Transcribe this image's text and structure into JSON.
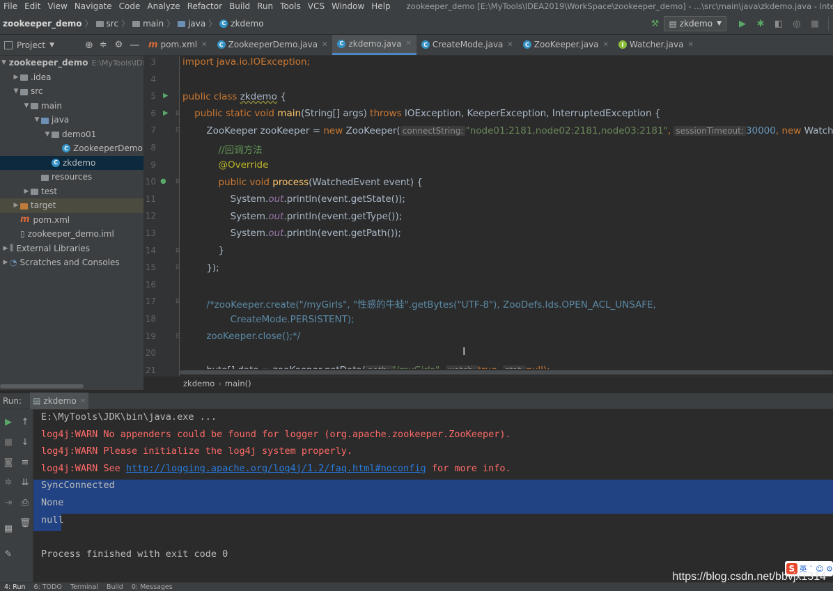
{
  "menu": [
    "File",
    "Edit",
    "View",
    "Navigate",
    "Code",
    "Analyze",
    "Refactor",
    "Build",
    "Run",
    "Tools",
    "VCS",
    "Window",
    "Help"
  ],
  "window_title": "zookeeper_demo [E:\\MyTools\\IDEA2019\\WorkSpace\\zookeeper_demo] - ...\\src\\main\\java\\zkdemo.java - IntelliJ IDEA",
  "breadcrumbs": [
    "zookeeper_demo",
    "src",
    "main",
    "java",
    "zkdemo"
  ],
  "run_config": "zkdemo",
  "project_panel": {
    "title": "Project",
    "tree": [
      {
        "label": "zookeeper_demo",
        "path": "E:\\MyTools\\IDEA201",
        "indent": 0,
        "arrow": "open",
        "icon": "folder",
        "bold": true
      },
      {
        "label": ".idea",
        "indent": 1,
        "arrow": "closed",
        "icon": "folder"
      },
      {
        "label": "src",
        "indent": 1,
        "arrow": "open",
        "icon": "folder"
      },
      {
        "label": "main",
        "indent": 2,
        "arrow": "open",
        "icon": "folder"
      },
      {
        "label": "java",
        "indent": 3,
        "arrow": "open",
        "icon": "folder-blue"
      },
      {
        "label": "demo01",
        "indent": 4,
        "arrow": "open",
        "icon": "folder"
      },
      {
        "label": "ZookeeperDemo",
        "indent": 5,
        "arrow": "none",
        "icon": "class"
      },
      {
        "label": "zkdemo",
        "indent": 4,
        "arrow": "none",
        "icon": "class",
        "selected": true
      },
      {
        "label": "resources",
        "indent": 3,
        "arrow": "none",
        "icon": "folder"
      },
      {
        "label": "test",
        "indent": 2,
        "arrow": "closed",
        "icon": "folder"
      },
      {
        "label": "target",
        "indent": 1,
        "arrow": "closed",
        "icon": "folder-orange",
        "highlight": true
      },
      {
        "label": "pom.xml",
        "indent": 1,
        "arrow": "none",
        "icon": "maven"
      },
      {
        "label": "zookeeper_demo.iml",
        "indent": 1,
        "arrow": "none",
        "icon": "file"
      },
      {
        "label": "External Libraries",
        "indent": 0,
        "arrow": "closed",
        "icon": "library"
      },
      {
        "label": "Scratches and Consoles",
        "indent": 0,
        "arrow": "closed",
        "icon": "scratch"
      }
    ]
  },
  "editor_tabs": [
    {
      "label": "pom.xml",
      "icon": "maven"
    },
    {
      "label": "ZookeeperDemo.java",
      "icon": "class"
    },
    {
      "label": "zkdemo.java",
      "icon": "class",
      "active": true
    },
    {
      "label": "CreateMode.java",
      "icon": "class"
    },
    {
      "label": "ZooKeeper.java",
      "icon": "class"
    },
    {
      "label": "Watcher.java",
      "icon": "interface"
    }
  ],
  "line_numbers": [
    "3",
    "4",
    "5",
    "6",
    "7",
    "8",
    "9",
    "10",
    "11",
    "12",
    "13",
    "14",
    "15",
    "16",
    "17",
    "18",
    "19",
    "20",
    "21"
  ],
  "code": {
    "l3": "import java.io.IOException;",
    "l5a": "public class ",
    "l5b": "zkdemo",
    "l5c": " {",
    "l6a": "    public static void ",
    "l6b": "main",
    "l6c": "(String[] args) ",
    "l6d": "throws",
    "l6e": " IOException, KeeperException, InterruptedException {",
    "l7a": "        ZooKeeper zooKeeper = ",
    "l7b": "new",
    "l7c": " ZooKeeper(",
    "l7h1": "connectString:",
    "l7s": "\"node01:2181,node02:2181,node03:2181\"",
    "l7d": ", ",
    "l7h2": "sessionTimeout:",
    "l7n": "30000",
    "l7e": ", ",
    "l7f": "new",
    "l7g": " Watch",
    "l8": "            //回调方法",
    "l9": "            @Override",
    "l10a": "            public void ",
    "l10b": "process",
    "l10c": "(WatchedEvent event) {",
    "l11a": "                System.",
    "l11b": "out",
    "l11c": ".println(event.getState());",
    "l12a": "                System.",
    "l12b": "out",
    "l12c": ".println(event.getType());",
    "l13a": "                System.",
    "l13b": "out",
    "l13c": ".println(event.getPath());",
    "l14": "            }",
    "l15": "        });",
    "l17": "        /*zooKeeper.create(\"/myGirls\", \"性感的牛蛙\".getBytes(\"UTF-8\"), ZooDefs.Ids.OPEN_ACL_UNSAFE,",
    "l18": "                CreateMode.PERSISTENT);",
    "l19": "        zooKeeper.close();*/",
    "l21a": "        byte[] data = zooKeeper.getData(",
    "l21h1": "path:",
    "l21s": "\"/myGirls\"",
    "l21b": ", ",
    "l21h2": "watch:",
    "l21k": "true",
    "l21c": ", ",
    "l21h3": "stat:",
    "l21d": "null);"
  },
  "editor_breadcrumb": [
    "zkdemo",
    "main()"
  ],
  "run": {
    "label": "Run:",
    "tab": "zkdemo",
    "console": [
      {
        "text": "E:\\MyTools\\JDK\\bin\\java.exe ...",
        "color": "#bbbbbb"
      },
      {
        "text": "log4j:WARN No appenders could be found for logger (org.apache.zookeeper.ZooKeeper).",
        "color": "#ff6b68"
      },
      {
        "text": "log4j:WARN Please initialize the log4j system properly.",
        "color": "#ff6b68"
      },
      {
        "text_a": "log4j:WARN See ",
        "link": "http://logging.apache.org/log4j/1.2/faq.html#noconfig",
        "text_b": " for more info.",
        "color": "#ff6b68"
      },
      {
        "text": "SyncConnected",
        "color": "#bbbbbb"
      },
      {
        "text": "None",
        "color": "#bbbbbb"
      },
      {
        "text": "null",
        "color": "#bbbbbb"
      },
      {
        "text": "",
        "color": "#bbbbbb"
      },
      {
        "text": "Process finished with exit code 0",
        "color": "#bbbbbb"
      }
    ]
  },
  "bottom_tabs": [
    "4: Run",
    "6: TODO",
    "Terminal",
    "Build",
    "0: Messages"
  ],
  "watermark": "https://blog.csdn.net/bbvjx1314",
  "ime_badge": {
    "logo": "S",
    "text": "英 ˋ ☺ ⚙"
  }
}
